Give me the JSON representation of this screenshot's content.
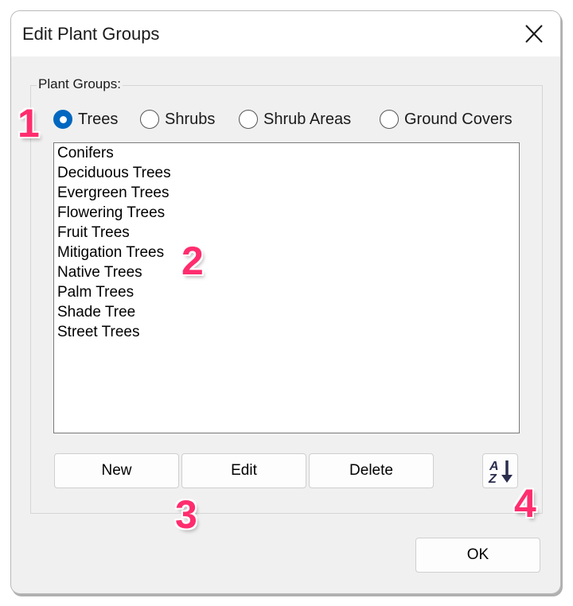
{
  "dialog": {
    "title": "Edit Plant Groups",
    "close_icon": "close-icon"
  },
  "group": {
    "label": "Plant Groups:",
    "radios": [
      {
        "label": "Trees",
        "selected": true
      },
      {
        "label": "Shrubs",
        "selected": false
      },
      {
        "label": "Shrub Areas",
        "selected": false
      },
      {
        "label": "Ground Covers",
        "selected": false
      }
    ]
  },
  "list": {
    "items": [
      "Conifers",
      "Deciduous Trees",
      "Evergreen Trees",
      "Flowering Trees",
      "Fruit Trees",
      "Mitigation Trees",
      "Native Trees",
      "Palm Trees",
      "Shade Tree",
      "Street Trees"
    ]
  },
  "buttons": {
    "new": "New",
    "edit": "Edit",
    "delete": "Delete",
    "sort_icon": "sort-az-icon",
    "ok": "OK"
  },
  "annotations": {
    "a1": "1",
    "a2": "2",
    "a3": "3",
    "a4": "4",
    "color": "#ff2d6e"
  },
  "colors": {
    "accent": "#0067c0",
    "dialog_bg": "#f0f0f0"
  }
}
